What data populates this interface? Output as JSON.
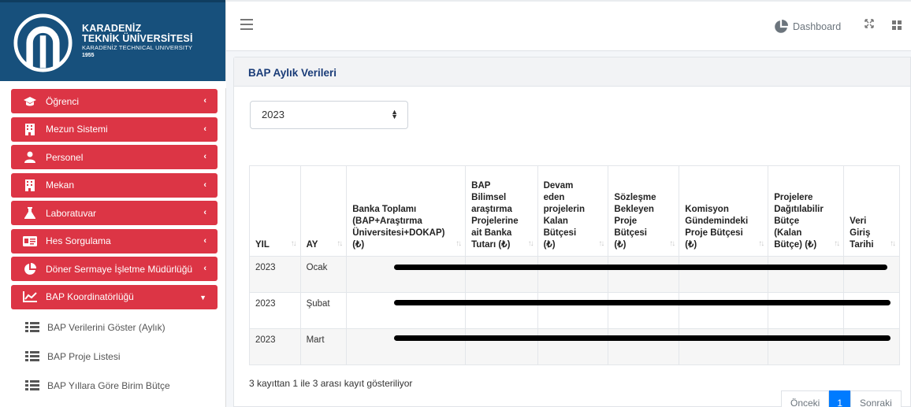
{
  "brand": {
    "line1": "KARADENİZ",
    "line2": "TEKNİK ÜNİVERSİTESİ",
    "line3": "KARADENİZ TECHNICAL UNIVERSITY",
    "line4": "1955",
    "color": "#17507c"
  },
  "sidebar": {
    "accent": "#dc3545",
    "items": [
      {
        "label": "Öğrenci",
        "icon": "graduation-cap-icon"
      },
      {
        "label": "Mezun Sistemi",
        "icon": "building-icon"
      },
      {
        "label": "Personel",
        "icon": "users-icon"
      },
      {
        "label": "Mekan",
        "icon": "building-icon"
      },
      {
        "label": "Laboratuvar",
        "icon": "flask-icon"
      },
      {
        "label": "Hes Sorgulama",
        "icon": "id-card-icon"
      },
      {
        "label": "Döner Sermaye İşletme Müdürlüğü",
        "icon": "pie-chart-icon"
      },
      {
        "label": "BAP Koordinatörlüğü",
        "icon": "line-chart-icon",
        "expanded": true
      }
    ],
    "subitems": [
      {
        "label": "BAP Verilerini Göster (Aylık)",
        "icon": "list-icon"
      },
      {
        "label": "BAP Proje Listesi",
        "icon": "list-icon"
      },
      {
        "label": "BAP Yıllara Göre Birim Bütçe",
        "icon": "list-icon"
      }
    ]
  },
  "topbar": {
    "dashboard_label": "Dashboard",
    "menu_icon": "hamburger-icon",
    "expand_icon": "expand-icon",
    "apps_icon": "apps-grid-icon"
  },
  "card": {
    "title": "BAP Aylık Verileri"
  },
  "filter": {
    "year_value": "2023"
  },
  "table": {
    "headers": [
      "YIL",
      "AY",
      "Banka Toplamı (BAP+Araştırma Üniversitesi+DOKAP) (₺)",
      "BAP Bilimsel araştırma Projelerine ait Banka Tutarı (₺)",
      "Devam eden projelerin Kalan Bütçesi (₺)",
      "Sözleşme Bekleyen Proje Bütçesi (₺)",
      "Komisyon Gündemindeki Proje Bütçesi (₺)",
      "Projelere Dağıtılabilir Bütçe (Kalan Bütçe) (₺)",
      "Veri Giriş Tarihi"
    ],
    "rows": [
      {
        "yil": "2023",
        "ay": "Ocak"
      },
      {
        "yil": "2023",
        "ay": "Şubat"
      },
      {
        "yil": "2023",
        "ay": "Mart"
      }
    ]
  },
  "footer": {
    "info": "3 kayıttan 1 ile 3 arası kayıt gösteriliyor",
    "prev": "Önceki",
    "page": "1",
    "next": "Sonraki"
  }
}
